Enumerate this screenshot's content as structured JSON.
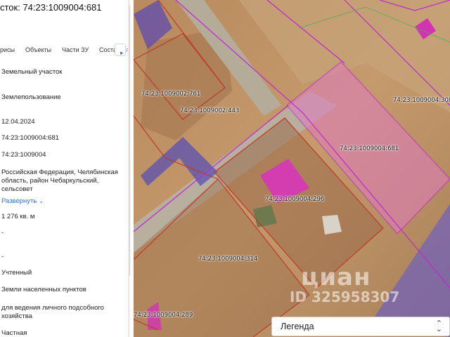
{
  "panel": {
    "title": "сток: 74:23:1009004:681",
    "tabs": [
      "рисы",
      "Объекты",
      "Части ЗУ",
      "Соста"
    ],
    "tab_arrow": "▸",
    "tab_cut": "я",
    "rows": {
      "type": "Земельный участок",
      "category_kind": "Землепользование",
      "date": "12.04.2024",
      "cad_number": "74:23:1009004:681",
      "quarter": "74:23:1009004",
      "address": "Российская Федерация, Челябинская область, район Чебаркульский, сельсовет",
      "expand_link": "Развернуть",
      "area": "1 276 кв. м",
      "dash1": "-",
      "dash2": "-",
      "status": "Учтенный",
      "land_category": "Земли населенных пунктов",
      "permitted_use": "для ведения личного подсобного хозяйства",
      "ownership": "Частная"
    }
  },
  "map": {
    "labels": {
      "l761": "74:23:1009002:761",
      "l443": "74:23:1009002:443",
      "l681": "74:23:1009004:681",
      "l308": "74:23:1009004:308",
      "l296": "74:23:1009004:296",
      "l314": "74:23:1009004:314",
      "l289": "74:23:1009004:289"
    },
    "watermark_brand": "циан",
    "watermark_id": "ID 325958307",
    "legend_label": "Легенда",
    "colors": {
      "boundary_red": "#c0392b",
      "boundary_magenta": "#c026d3",
      "highlight_fill": "#e879b8",
      "road": "#b8ad9c",
      "ground": "#c99a6b"
    }
  }
}
